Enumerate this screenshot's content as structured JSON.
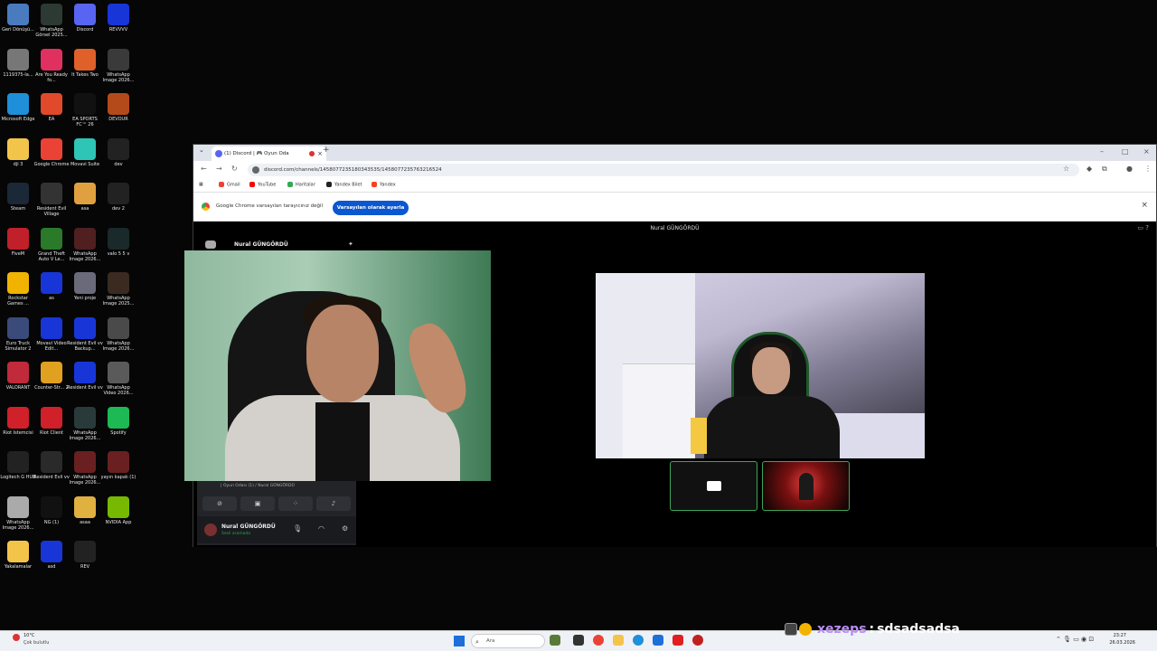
{
  "desktop": {
    "icons": [
      {
        "label": "Geri Dönüşü...",
        "color": "#4a7bbf"
      },
      {
        "label": "WhatsApp Görsel 2025...",
        "color": "#2c3a33"
      },
      {
        "label": "Discord",
        "color": "#5865f2"
      },
      {
        "label": "REVVVV",
        "color": "#1836d8"
      },
      {
        "label": "1119375-la...",
        "color": "#777"
      },
      {
        "label": "Are You Ready fo...",
        "color": "#e03060"
      },
      {
        "label": "It Takes Two",
        "color": "#e0602a"
      },
      {
        "label": "WhatsApp Image 2026...",
        "color": "#3a3a3a"
      },
      {
        "label": "Microsoft Edge",
        "color": "#1e8fd8"
      },
      {
        "label": "EA",
        "color": "#e04a2a"
      },
      {
        "label": "EA SPORTS FC™ 26",
        "color": "#111"
      },
      {
        "label": "DEVOUR",
        "color": "#b44a1a"
      },
      {
        "label": "dji 3",
        "color": "#f2c44a"
      },
      {
        "label": "Google Chrome",
        "color": "#ea4335"
      },
      {
        "label": "Movavi Suite",
        "color": "#2ec4b6"
      },
      {
        "label": "dev",
        "color": "#222"
      },
      {
        "label": "Steam",
        "color": "#1b2838"
      },
      {
        "label": "Resident Evil Village",
        "color": "#333"
      },
      {
        "label": "asa",
        "color": "#e0a040"
      },
      {
        "label": "dev 2",
        "color": "#222"
      },
      {
        "label": "FiveM",
        "color": "#c0202a"
      },
      {
        "label": "Grand Theft Auto V Le...",
        "color": "#2a7a2a"
      },
      {
        "label": "WhatsApp Image 2026...",
        "color": "#502020"
      },
      {
        "label": "valo 5 5 v",
        "color": "#1a2a2a"
      },
      {
        "label": "Rockstar Games ...",
        "color": "#f0b400"
      },
      {
        "label": "as",
        "color": "#1836d8"
      },
      {
        "label": "Yeni proje",
        "color": "#6a6a7a"
      },
      {
        "label": "WhatsApp Image 2025...",
        "color": "#3a2a20"
      },
      {
        "label": "Euro Truck Simulator 2",
        "color": "#3a4a7a"
      },
      {
        "label": "Movavi Video Edit...",
        "color": "#1836d8"
      },
      {
        "label": "Resident Evil vv Backup...",
        "color": "#1836d8"
      },
      {
        "label": "WhatsApp Image 2026...",
        "color": "#4a4a4a"
      },
      {
        "label": "VALORANT",
        "color": "#c02a3a"
      },
      {
        "label": "Counter-Str... 2",
        "color": "#e0a020"
      },
      {
        "label": "Resident Evil vv",
        "color": "#1836d8"
      },
      {
        "label": "WhatsApp Video 2026...",
        "color": "#5a5a5a"
      },
      {
        "label": "Riot İstemcisi",
        "color": "#d0202a"
      },
      {
        "label": "Riot Client",
        "color": "#d0202a"
      },
      {
        "label": "WhatsApp Image 2026...",
        "color": "#2a3a3a"
      },
      {
        "label": "Spotify",
        "color": "#1db954"
      },
      {
        "label": "Logitech G HUB",
        "color": "#222"
      },
      {
        "label": "Resident Evil vv",
        "color": "#2a2a2a"
      },
      {
        "label": "WhatsApp Image 2026...",
        "color": "#6a2020"
      },
      {
        "label": "yayın kapalı (1)",
        "color": "#6a2020"
      },
      {
        "label": "WhatsApp Image 2026...",
        "color": "#aaa"
      },
      {
        "label": "NG (1)",
        "color": "#111"
      },
      {
        "label": "asaa",
        "color": "#e0b040"
      },
      {
        "label": "NVIDIA App",
        "color": "#76b900"
      },
      {
        "label": "Yakalamalar",
        "color": "#f2c44a"
      },
      {
        "label": "asd",
        "color": "#1836d8"
      },
      {
        "label": "REV",
        "color": "#222"
      }
    ]
  },
  "browser": {
    "tab_title": "(1) Discord | 🎮 Oyun Oda",
    "url": "discord.com/channels/1458077235180343535/1458077235763216524",
    "bookmarks": [
      "Gmail",
      "YouTube",
      "Haritalar",
      "Yandex Bilet",
      "Yandex"
    ],
    "infobar": {
      "text": "Google Chrome varsayılan tarayıcınız değil",
      "button": "Varsayılan olarak ayarla"
    }
  },
  "discord": {
    "call_title": "Nural GÜNGÖRDÜ",
    "server_name": "Nural GÜNGÖRDÜ",
    "voice_status": "Görüntülü Bağlantı Kuruldu",
    "voice_room": "| Oyun Odası (1) / Nural GÜNGÖRDÜ",
    "user_name": "Nural GÜNGÖRDÜ",
    "user_status": "Sesli aramada"
  },
  "overlay": {
    "chat_user": "xezeps",
    "chat_sep": ":",
    "chat_message": "sdsadsadsa"
  },
  "taskbar": {
    "weather_temp": "10°C",
    "weather_desc": "Çok bulutlu",
    "search_placeholder": "Ara",
    "clock_time": "23:27",
    "clock_date": "26.03.2026"
  }
}
